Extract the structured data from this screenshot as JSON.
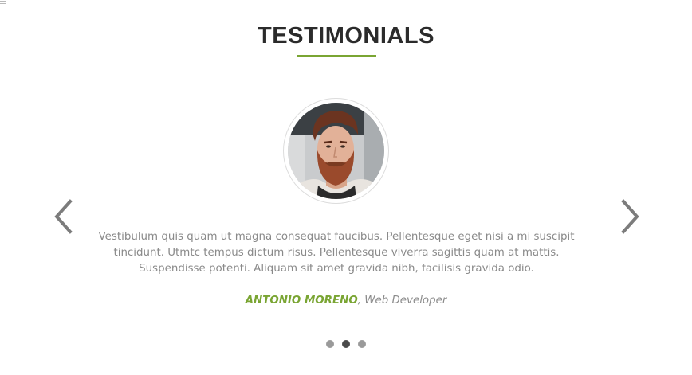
{
  "section": {
    "title": "TESTIMONIALS"
  },
  "testimonial": {
    "quote_lines": [
      "Vestibulum quis quam ut magna consequat faucibus. Pellentesque eget nisi a mi suscipit",
      "tincidunt. Utmtc tempus dictum risus. Pellentesque viverra sagittis quam at mattis.",
      "Suspendisse potenti. Aliquam sit amet gravida nibh, facilisis gravida odio."
    ],
    "author_name": "ANTONIO MORENO",
    "separator": ",",
    "author_role": "Web Developer"
  },
  "carousel": {
    "prev_icon": "chevron-left-icon",
    "next_icon": "chevron-right-icon",
    "dot_count": 3,
    "active_index": 1
  },
  "colors": {
    "accent": "#7aa533",
    "title": "#2b2b2b",
    "text": "#8a8a8a",
    "arrow": "#7c7c7c",
    "dot_inactive": "#9a9a9a",
    "dot_active": "#4a4a4a"
  }
}
